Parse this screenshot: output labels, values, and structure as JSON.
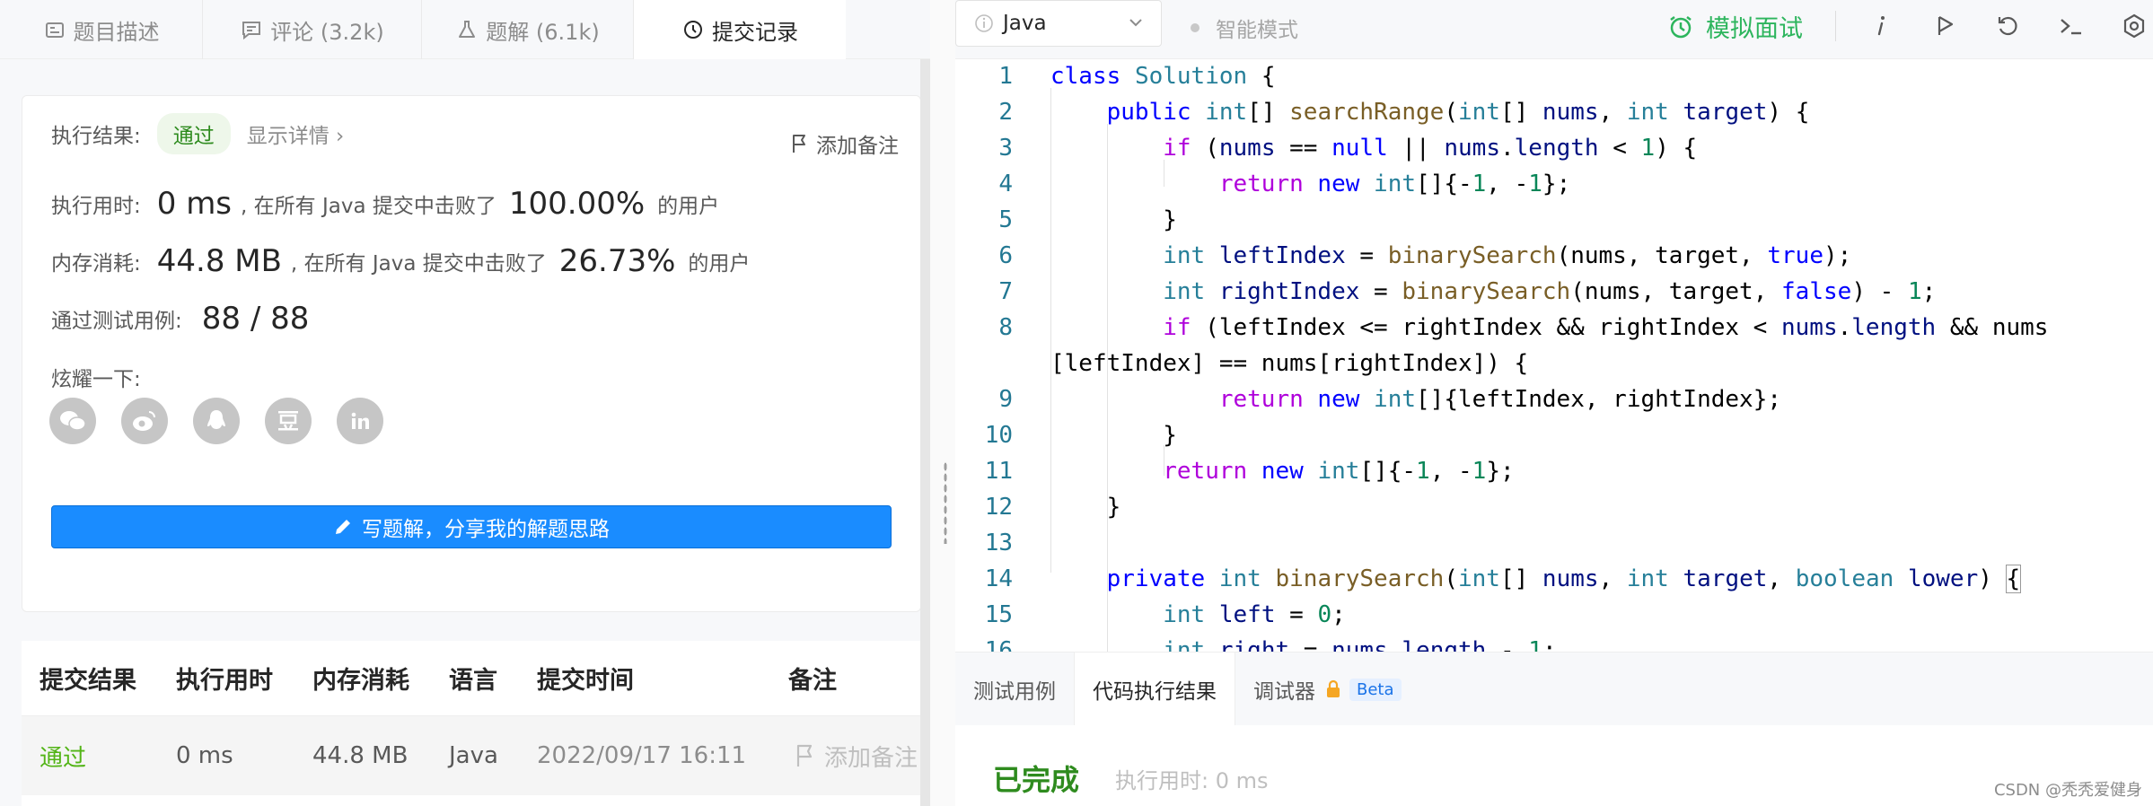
{
  "left_tabs": [
    {
      "label": "题目描述",
      "icon": "description-icon"
    },
    {
      "label": "评论 (3.2k)",
      "icon": "comment-icon"
    },
    {
      "label": "题解 (6.1k)",
      "icon": "flask-icon"
    },
    {
      "label": "提交记录",
      "icon": "clock-icon",
      "active": true
    }
  ],
  "result": {
    "result_label": "执行结果:",
    "status": "通过",
    "detail_link": "显示详情 ›",
    "add_note": "添加备注",
    "time_label": "执行用时:",
    "time_value": "0 ms",
    "time_text": ", 在所有 Java 提交中击败了",
    "time_percent": "100.00%",
    "time_suffix": "的用户",
    "mem_label": "内存消耗:",
    "mem_value": "44.8 MB",
    "mem_text": ", 在所有 Java 提交中击败了",
    "mem_percent": "26.73%",
    "mem_suffix": "的用户",
    "tests_label": "通过测试用例:",
    "tests_value": "88 / 88",
    "share_label": "炫耀一下:",
    "share_icons": [
      "wechat-icon",
      "weibo-icon",
      "qq-icon",
      "douban-icon",
      "linkedin-icon"
    ],
    "write_button": "写题解，分享我的解题思路"
  },
  "submissions": {
    "headers": [
      "提交结果",
      "执行用时",
      "内存消耗",
      "语言",
      "提交时间",
      "备注"
    ],
    "rows": [
      {
        "status": "通过",
        "time": "0 ms",
        "memory": "44.8 MB",
        "lang": "Java",
        "submitted": "2022/09/17 16:11",
        "note": "添加备注"
      }
    ]
  },
  "toolbar": {
    "language": "Java",
    "smart_mode": "智能模式",
    "mock_interview": "模拟面试",
    "accent": "#2db55d"
  },
  "editor": {
    "line_numbers": [
      "1",
      "2",
      "3",
      "4",
      "5",
      "6",
      "7",
      "8",
      "",
      "9",
      "10",
      "11",
      "12",
      "13",
      "14",
      "15",
      "16"
    ]
  },
  "bottom_tabs": {
    "test_cases": "测试用例",
    "run_result": "代码执行结果",
    "debugger": "调试器",
    "beta": "Beta"
  },
  "run_output": {
    "status": "已完成",
    "exec_time": "执行用时: 0 ms"
  },
  "watermark": "CSDN @秃秃爱健身"
}
